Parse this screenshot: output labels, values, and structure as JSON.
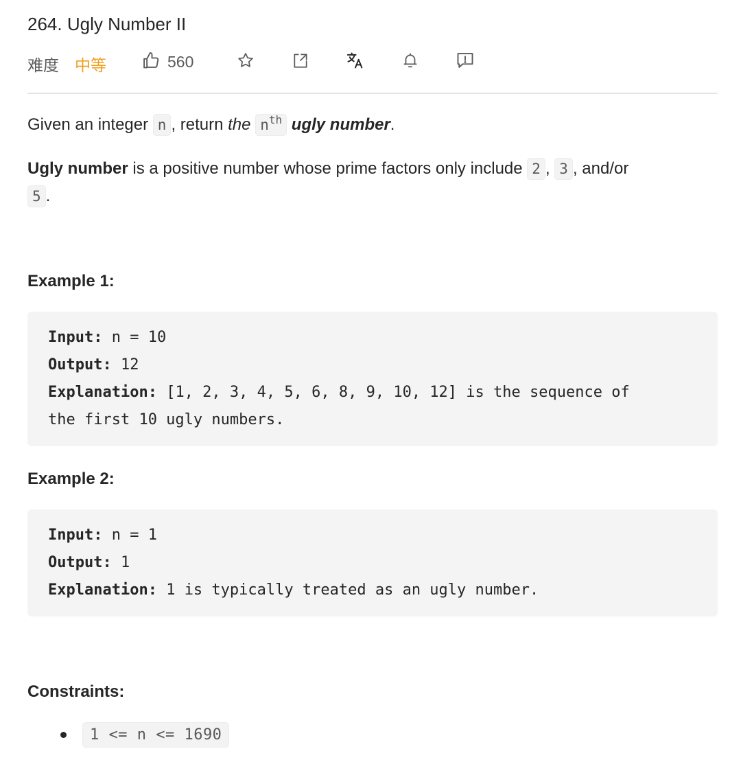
{
  "problem": {
    "title": "264. Ugly Number II",
    "difficulty_label": "难度",
    "difficulty_value": "中等",
    "likes": "560"
  },
  "toolbar": {
    "icons": [
      "thumbs-up-icon",
      "star-icon",
      "share-icon",
      "translate-icon",
      "bell-icon",
      "feedback-icon"
    ]
  },
  "description": {
    "p1_before": "Given an integer ",
    "p1_code_n": "n",
    "p1_mid": ", return ",
    "p1_the": "the",
    "p1_code_nth": "n",
    "p1_sup": "th",
    "p1_bold": "ugly number",
    "p1_end": ".",
    "p2_bold": "Ugly number",
    "p2_text": " is a positive number whose prime factors only include ",
    "p2_code_2": "2",
    "p2_comma": ", ",
    "p2_code_3": "3",
    "p2_andor": ", and/or",
    "p2_code_5": "5",
    "p2_end": "."
  },
  "examples": [
    {
      "heading": "Example 1:",
      "input_label": "Input:",
      "input": " n = 10",
      "output_label": "Output:",
      "output": " 12",
      "explanation_label": "Explanation:",
      "explanation_line1": " [1, 2, 3, 4, 5, 6, 8, 9, 10, 12] is the sequence of",
      "explanation_line2": "the first 10 ugly numbers."
    },
    {
      "heading": "Example 2:",
      "input_label": "Input:",
      "input": " n = 1",
      "output_label": "Output:",
      "output": " 1",
      "explanation_label": "Explanation:",
      "explanation_line1": " 1 is typically treated as an ugly number."
    }
  ],
  "constraints": {
    "heading": "Constraints:",
    "items": [
      "1 <= n <= 1690"
    ]
  },
  "colors": {
    "difficulty_medium": "#f0a020",
    "text": "#262626",
    "code_bg": "#f4f4f4"
  }
}
